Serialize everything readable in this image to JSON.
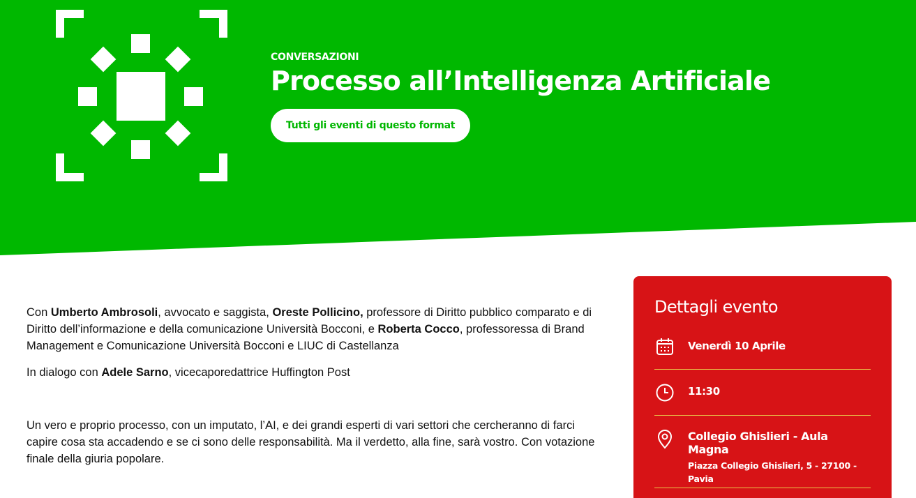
{
  "colors": {
    "hero_green": "#00b800",
    "card_red": "#d71316",
    "divider": "#e8c84a"
  },
  "hero": {
    "category": "CONVERSAZIONI",
    "title": "Processo all’Intelligenza Artificiale",
    "format_button": "Tutti gli eventi di questo format",
    "logo_icon": "sparkle-frame-icon"
  },
  "body": {
    "p1": {
      "t1": "Con ",
      "b1": "Umberto Ambrosoli",
      "t2": ", avvocato e saggista, ",
      "b2": "Oreste Pollicino,",
      "t3": " professore di Diritto pubblico comparato e di Diritto dell’informazione e della comunicazione Università Bocconi, e ",
      "b3": "Roberta Cocco",
      "t4": ", professoressa di Brand Management e Comunicazione Università Bocconi e LIUC di Castellanza"
    },
    "p2": {
      "t1": "In dialogo con ",
      "b1": "Adele Sarno",
      "t2": ", vicecaporedattrice Huffington Post"
    },
    "p3": "Un vero e proprio processo, con un imputato, l’AI, e dei grandi esperti di vari settori che cercheranno di farci capire cosa sta accadendo e se ci sono delle responsabilità. Ma il verdetto, alla fine, sarà vostro. Con votazione finale della giuria popolare."
  },
  "event_card": {
    "title": "Dettagli evento",
    "date": "Venerdì 10 Aprile",
    "time": "11:30",
    "venue": "Collegio Ghislieri - Aula Magna",
    "address": "Piazza Collegio Ghislieri, 5 - 27100 - Pavia",
    "icons": {
      "date": "calendar-icon",
      "time": "clock-icon",
      "venue": "location-pin-icon"
    }
  }
}
